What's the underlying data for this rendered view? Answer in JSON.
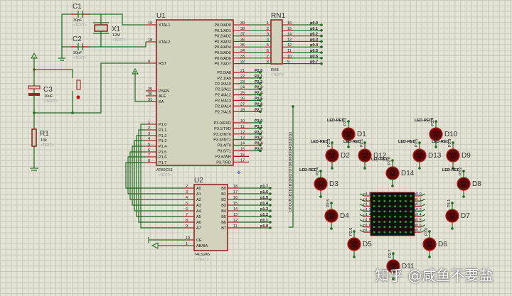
{
  "u1": {
    "ref": "U1",
    "part": "AT89C51",
    "text": "<TEXT>",
    "left_pins": [
      {
        "num": "19",
        "name": "XTAL1"
      },
      {
        "num": "18",
        "name": "XTAL2"
      },
      {
        "num": "9",
        "name": "RST"
      },
      {
        "num": "29",
        "name": "PSEN"
      },
      {
        "num": "30",
        "name": "ALE"
      },
      {
        "num": "31",
        "name": "EA"
      },
      {
        "num": "1",
        "name": "P1.0"
      },
      {
        "num": "2",
        "name": "P1.1"
      },
      {
        "num": "3",
        "name": "P1.2"
      },
      {
        "num": "4",
        "name": "P1.3"
      },
      {
        "num": "5",
        "name": "P1.4"
      },
      {
        "num": "6",
        "name": "P1.5"
      },
      {
        "num": "7",
        "name": "P1.6"
      },
      {
        "num": "8",
        "name": "P1.7"
      }
    ],
    "right_pins": [
      {
        "num": "39",
        "name": "P0.0/AD0"
      },
      {
        "num": "38",
        "name": "P0.1/AD1"
      },
      {
        "num": "37",
        "name": "P0.2/AD2"
      },
      {
        "num": "36",
        "name": "P0.3/AD3"
      },
      {
        "num": "35",
        "name": "P0.4/AD4"
      },
      {
        "num": "34",
        "name": "P0.5/AD5"
      },
      {
        "num": "33",
        "name": "P0.6/AD6"
      },
      {
        "num": "32",
        "name": "P0.7/AD7"
      },
      {
        "num": "21",
        "name": "P2.0/A8",
        "net": "P2.0"
      },
      {
        "num": "22",
        "name": "P2.1/A9",
        "net": "P2.1"
      },
      {
        "num": "23",
        "name": "P2.2/A10",
        "net": "P2.2"
      },
      {
        "num": "24",
        "name": "P2.3/A11",
        "net": "P2.3"
      },
      {
        "num": "25",
        "name": "P2.4/A12",
        "net": "P2.4"
      },
      {
        "num": "26",
        "name": "P2.5/A13",
        "net": "P2.5"
      },
      {
        "num": "27",
        "name": "P2.6/A14",
        "net": "P2.6"
      },
      {
        "num": "28",
        "name": "P2.7/A15",
        "net": "P2.7"
      },
      {
        "num": "10",
        "name": "P3.0/RXD",
        "net": "P3.0"
      },
      {
        "num": "11",
        "name": "P3.1/TXD",
        "net": "P3.1"
      },
      {
        "num": "12",
        "name": "P3.2/INT0",
        "net": "P3.2"
      },
      {
        "num": "13",
        "name": "P3.3/INT1",
        "net": "P3.3"
      },
      {
        "num": "14",
        "name": "P3.4/T0",
        "net": "P3.4"
      },
      {
        "num": "15",
        "name": "P3.5/T1",
        "net": "P3.5"
      },
      {
        "num": "16",
        "name": "P3.6/WR"
      },
      {
        "num": "17",
        "name": "P3.7/RD"
      }
    ]
  },
  "rn1": {
    "ref": "RN1",
    "part": "RX8",
    "text": "<TEXT>",
    "left_nums": [
      "1",
      "2",
      "3",
      "4",
      "5",
      "6",
      "7",
      "8"
    ],
    "right_nums": [
      "16",
      "15",
      "14",
      "13",
      "12",
      "11",
      "10",
      "9"
    ],
    "nets": [
      "p0.0",
      "p0.1",
      "p0.2",
      "p0.3",
      "p0.4",
      "p0.5",
      "p0.6",
      "p0.7"
    ]
  },
  "u2": {
    "ref": "U2",
    "part": "74LS245",
    "text": "<TEXT>",
    "left_pins": [
      {
        "num": "2",
        "name": "A0"
      },
      {
        "num": "3",
        "name": "A1"
      },
      {
        "num": "4",
        "name": "A2"
      },
      {
        "num": "5",
        "name": "A3"
      },
      {
        "num": "6",
        "name": "A4"
      },
      {
        "num": "7",
        "name": "A5"
      },
      {
        "num": "8",
        "name": "A6"
      },
      {
        "num": "9",
        "name": "A7"
      },
      {
        "num": "19",
        "name": "CE"
      },
      {
        "num": "1",
        "name": "AB/BA"
      }
    ],
    "right_pins": [
      {
        "num": "18",
        "name": "B0",
        "net": "p1.7"
      },
      {
        "num": "17",
        "name": "B1",
        "net": "p1.6"
      },
      {
        "num": "16",
        "name": "B2",
        "net": "p1.5"
      },
      {
        "num": "15",
        "name": "B3",
        "net": "p1.4"
      },
      {
        "num": "14",
        "name": "B4",
        "net": "p1.3"
      },
      {
        "num": "13",
        "name": "B5",
        "net": "p1.2"
      },
      {
        "num": "12",
        "name": "B6",
        "net": "p1.1"
      },
      {
        "num": "11",
        "name": "B7",
        "net": "p1.0"
      }
    ]
  },
  "passives": {
    "c1": {
      "ref": "C1",
      "value": "30pF",
      "text": "<TEXT>"
    },
    "c2": {
      "ref": "C2",
      "value": "30pF",
      "text": "<TEXT>"
    },
    "x1": {
      "ref": "X1",
      "value": "12M",
      "text": "<TEXT>"
    },
    "c3": {
      "ref": "C3",
      "value": "10uF",
      "text": "<TEXT>"
    },
    "r1": {
      "ref": "R1",
      "value": "10k",
      "text": "<TEXT>"
    }
  },
  "bus": {
    "label": "D1B1B2D1B1D8D7D7D6D6D5D4D3D2D1",
    "pin": "D8"
  },
  "leds": [
    {
      "ref": "D1",
      "net": "P2.2",
      "part": "LED-RED"
    },
    {
      "ref": "D2",
      "net": "P2.3",
      "part": "LED-RED"
    },
    {
      "ref": "D12",
      "net": "P2.1",
      "part": "LED-RED"
    },
    {
      "ref": "D14",
      "net": "P2.0",
      "part": "LED-RED"
    },
    {
      "ref": "D13",
      "net": "P3.5",
      "part": "LED-RED"
    },
    {
      "ref": "D10",
      "net": "P3.4",
      "part": "LED-RED"
    },
    {
      "ref": "D9",
      "net": "P3.3",
      "part": "LED-RED"
    },
    {
      "ref": "D3",
      "net": "P2.4",
      "part": "LED-RED"
    },
    {
      "ref": "D8",
      "net": "P3.2",
      "part": "LED-RED"
    },
    {
      "ref": "D4",
      "net": "P2.5",
      "part": "LED-RED"
    },
    {
      "ref": "D7",
      "net": "P3.1",
      "part": "LED-RED"
    },
    {
      "ref": "D5",
      "net": "P2.6",
      "part": "LED-RED"
    },
    {
      "ref": "D6",
      "net": "P3.0",
      "part": "LED-RED"
    },
    {
      "ref": "D11",
      "net": "P2.7",
      "part": "LED-RED"
    }
  ],
  "matrix": {
    "rows": 8,
    "cols": 8,
    "left_nets": [
      "p1.0",
      "p1.1",
      "p1.2",
      "p1.3",
      "p1.4",
      "p1.5",
      "p1.6",
      "p1.7"
    ],
    "right_nets": [
      "p0.0",
      "p0.1",
      "p0.2",
      "p0.3",
      "p0.4",
      "p0.5",
      "p0.6",
      "p0.7"
    ]
  },
  "colors": {
    "wire": "#1f6a1f",
    "component_border": "#8a1c1c",
    "led": "#5a0a0a",
    "matrix_dot": "#1aa01a"
  },
  "watermark": "知乎 @咸鱼不要盐"
}
